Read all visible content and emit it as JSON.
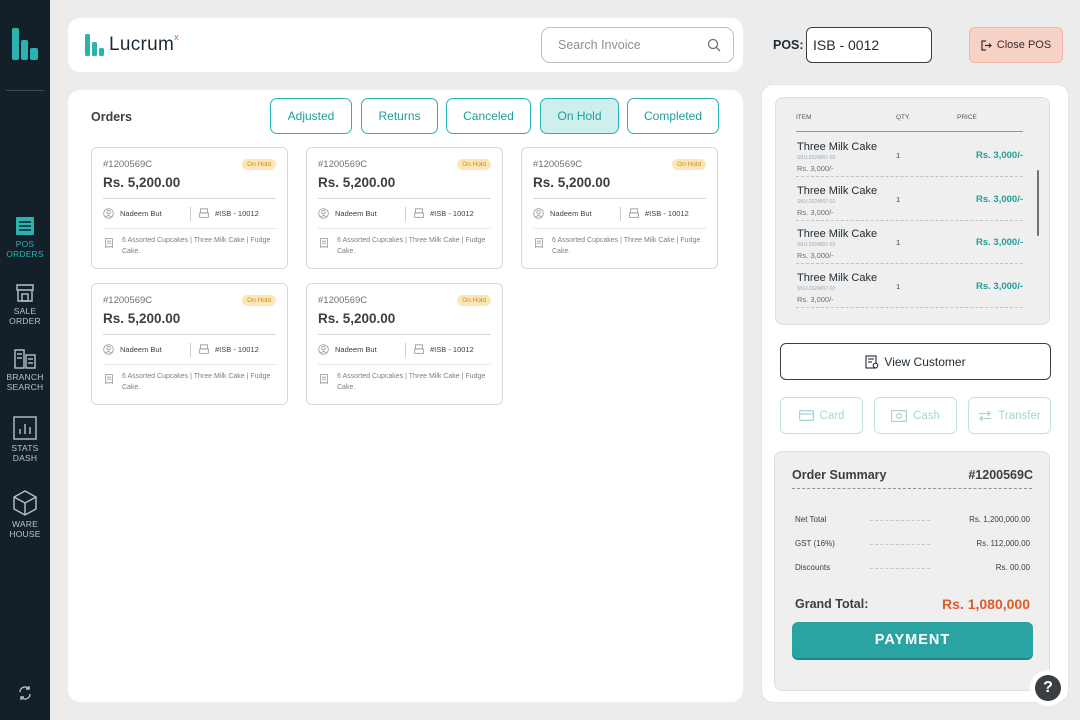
{
  "brand": {
    "name": "Lucrum",
    "superscript": "x"
  },
  "search": {
    "placeholder": "Search Invoice"
  },
  "pos": {
    "label": "POS:",
    "value": "ISB - 0012",
    "close_label": "Close POS"
  },
  "sidebar": {
    "items": [
      {
        "line1": "POS",
        "line2": "ORDERS",
        "icon": "list-icon",
        "active": true
      },
      {
        "line1": "SALE",
        "line2": "ORDER",
        "icon": "store-icon",
        "active": false
      },
      {
        "line1": "BRANCH",
        "line2": "SEARCH",
        "icon": "branch-icon",
        "active": false
      },
      {
        "line1": "STATS",
        "line2": "DASH",
        "icon": "stats-icon",
        "active": false
      },
      {
        "line1": "WARE",
        "line2": "HOUSE",
        "icon": "box-icon",
        "active": false
      }
    ]
  },
  "orders": {
    "title": "Orders",
    "filters": [
      "Adjusted",
      "Returns",
      "Canceled",
      "On Hold",
      "Completed"
    ],
    "active_filter": "On Hold",
    "cards": [
      {
        "id": "#1200569C",
        "status": "On Hold",
        "amount": "Rs. 5,200.00",
        "customer": "Nadeem But",
        "pos": "#ISB - 10012",
        "items": "6 Assorted Cupcakes | Three Milk Cake | Fudge Cake."
      },
      {
        "id": "#1200569C",
        "status": "On Hold",
        "amount": "Rs. 5,200.00",
        "customer": "Nadeem But",
        "pos": "#ISB - 10012",
        "items": "6 Assorted Cupcakes | Three Milk Cake | Fudge Cake."
      },
      {
        "id": "#1200569C",
        "status": "On Hold",
        "amount": "Rs. 5,200.00",
        "customer": "Nadeem But",
        "pos": "#ISB - 10012",
        "items": "6 Assorted Cupcakes | Three Milk Cake | Fudge Cake."
      },
      {
        "id": "#1200569C",
        "status": "On Hold",
        "amount": "Rs. 5,200.00",
        "customer": "Nadeem But",
        "pos": "#ISB - 10012",
        "items": "6 Assorted Cupcakes | Three Milk Cake | Fudge Cake."
      },
      {
        "id": "#1200569C",
        "status": "On Hold",
        "amount": "Rs. 5,200.00",
        "customer": "Nadeem But",
        "pos": "#ISB - 10012",
        "items": "6 Assorted Cupcakes | Three Milk Cake | Fudge Cake."
      }
    ]
  },
  "cart": {
    "headers": {
      "item": "ITEM",
      "qty": "QTY.",
      "price": "PRICE"
    },
    "rows": [
      {
        "name": "Three Milk Cake",
        "sku": "SKU:2024897-02",
        "unit_price": "Rs. 3,000/-",
        "qty": "1",
        "price": "Rs. 3,000/-"
      },
      {
        "name": "Three Milk Cake",
        "sku": "SKU:2024897-02",
        "unit_price": "Rs. 3,000/-",
        "qty": "1",
        "price": "Rs. 3,000/-"
      },
      {
        "name": "Three Milk Cake",
        "sku": "SKU:2024897-02",
        "unit_price": "Rs. 3,000/-",
        "qty": "1",
        "price": "Rs. 3,000/-"
      },
      {
        "name": "Three Milk Cake",
        "sku": "SKU:2024897-02",
        "unit_price": "Rs. 3,000/-",
        "qty": "1",
        "price": "Rs. 3,000/-"
      }
    ]
  },
  "actions": {
    "view_customer": "View Customer",
    "card": "Card",
    "cash": "Cash",
    "transfer": "Transfer"
  },
  "summary": {
    "title": "Order Summary",
    "order_id": "#1200569C",
    "rows": [
      {
        "label": "Net Total",
        "value": "Rs. 1,200,000.00"
      },
      {
        "label": "GST (16%)",
        "value": "Rs. 112,000.00"
      },
      {
        "label": "Discounts",
        "value": "Rs. 00.00"
      }
    ],
    "grand_label": "Grand Total:",
    "grand_value": "Rs. 1,080,000",
    "payment_label": "PAYMENT"
  },
  "help": {
    "label": "?"
  },
  "colors": {
    "teal": "#2ab3b1",
    "sidebar": "#13202a",
    "accent_orange": "#e05a2a",
    "badge_bg": "#fbe6b8"
  }
}
